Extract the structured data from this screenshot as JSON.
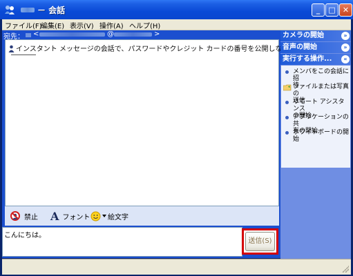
{
  "window": {
    "title": "－ 会話",
    "minimize_label": "_",
    "maximize_label": "□",
    "close_label": "✕"
  },
  "menubar": {
    "items": [
      {
        "label": "ファイル(F)"
      },
      {
        "label": "編集(E)"
      },
      {
        "label": "表示(V)"
      },
      {
        "label": "操作(A)"
      },
      {
        "label": "ヘルプ(H)"
      }
    ]
  },
  "recipient": {
    "label": "宛先：",
    "open_bracket": "<",
    "at_sign": "@",
    "close_bracket": ">"
  },
  "transcript": {
    "notice": "インスタント メッセージの会話で、パスワードやクレジット カードの番号を公開しないでください。"
  },
  "toolbar": {
    "block_label": "禁止",
    "font_label": "フォント",
    "font_glyph": "A",
    "emoticon_label": "絵文字"
  },
  "compose": {
    "text": "こんにちは。",
    "send_label": "送信(S)"
  },
  "sidebar": {
    "sections": [
      {
        "label": "カメラの開始",
        "chevron": "»"
      },
      {
        "label": "音声の開始",
        "chevron": "»"
      },
      {
        "label": "実行する操作...",
        "chevron": "«"
      }
    ],
    "actions": [
      {
        "line1": "メンバをこの会話に招",
        "line2": "待",
        "icon": "bullet-icon"
      },
      {
        "line1": "ファイルまたは写真の",
        "line2": "送信",
        "icon": "folder-icon"
      },
      {
        "line1": "リモート アシスタンス",
        "line2": "の開始",
        "icon": "bullet-icon"
      },
      {
        "line1": "アプリケーションの共",
        "line2": "有の開始",
        "icon": "bullet-icon"
      },
      {
        "line1": "ホワイトボードの開始",
        "line2": "",
        "icon": "bullet-icon"
      }
    ]
  },
  "colors": {
    "title_bar": "#0A4AD6",
    "sidebar_header": "#1F5BD8",
    "send_highlight": "#D40000"
  }
}
